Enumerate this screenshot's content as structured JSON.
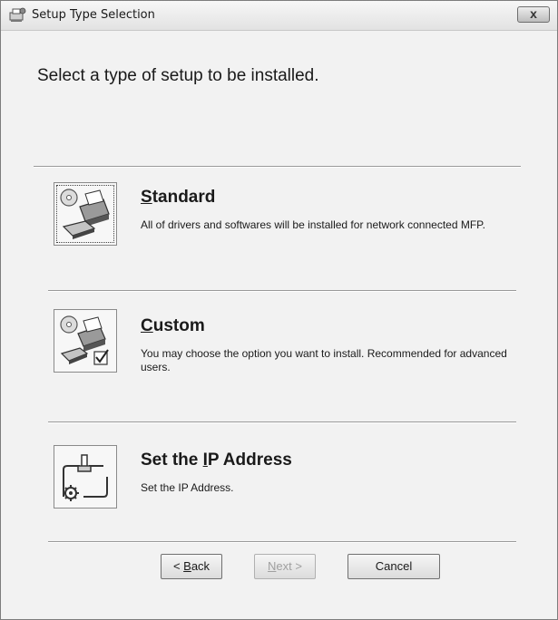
{
  "window": {
    "title": "Setup Type Selection",
    "close_label": "x"
  },
  "heading": "Select a type of setup to be installed.",
  "options": [
    {
      "title_key": "S",
      "title_rest": "tandard",
      "description": "All of drivers and softwares will be installed for network connected MFP.",
      "icon": "printer-setup-icon"
    },
    {
      "title_key": "C",
      "title_rest": "ustom",
      "description": "You may choose the option you want to install. Recommended for advanced users.",
      "icon": "custom-setup-icon"
    },
    {
      "title_pre": "Set the ",
      "title_key": "I",
      "title_rest": "P Address",
      "description": "Set the IP Address.",
      "icon": "network-address-icon"
    }
  ],
  "buttons": {
    "back": {
      "pre": "< ",
      "key": "B",
      "rest": "ack"
    },
    "next": {
      "key": "N",
      "rest": "ext >"
    },
    "cancel": {
      "label": "Cancel"
    }
  }
}
